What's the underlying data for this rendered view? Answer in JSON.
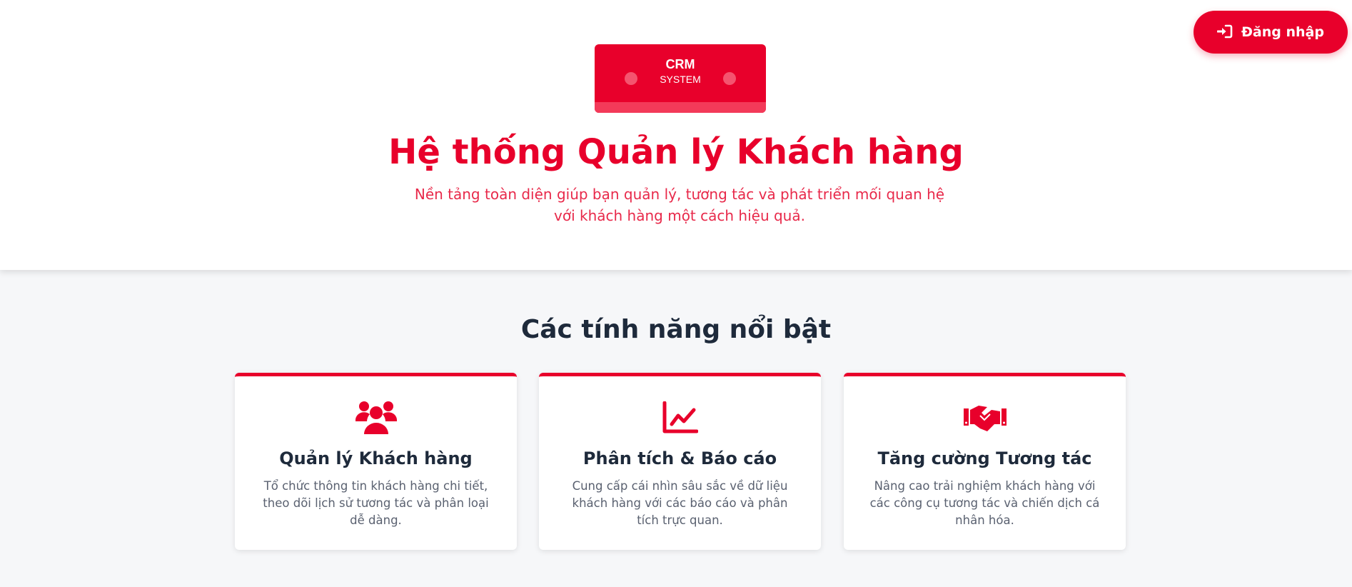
{
  "colors": {
    "brand": "#e8002b",
    "heading": "#1e2a3b",
    "text": "#5a6170",
    "background": "#f6f7f9"
  },
  "header": {
    "login_button": {
      "label": "Đăng nhập",
      "icon": "sign-in-icon"
    }
  },
  "logo": {
    "main_text": "CRM",
    "sub_text": "SYSTEM"
  },
  "hero": {
    "title": "Hệ thống Quản lý Khách hàng",
    "subtitle": "Nền tảng toàn diện giúp bạn quản lý, tương tác và phát triển mối quan hệ với khách hàng một cách hiệu quả."
  },
  "features": {
    "title": "Các tính năng nổi bật",
    "cards": [
      {
        "icon": "users-icon",
        "title": "Quản lý Khách hàng",
        "description": "Tổ chức thông tin khách hàng chi tiết, theo dõi lịch sử tương tác và phân loại dễ dàng."
      },
      {
        "icon": "chart-line-icon",
        "title": "Phân tích & Báo cáo",
        "description": "Cung cấp cái nhìn sâu sắc về dữ liệu khách hàng với các báo cáo và phân tích trực quan."
      },
      {
        "icon": "handshake-icon",
        "title": "Tăng cường Tương tác",
        "description": "Nâng cao trải nghiệm khách hàng với các công cụ tương tác và chiến dịch cá nhân hóa."
      }
    ]
  }
}
